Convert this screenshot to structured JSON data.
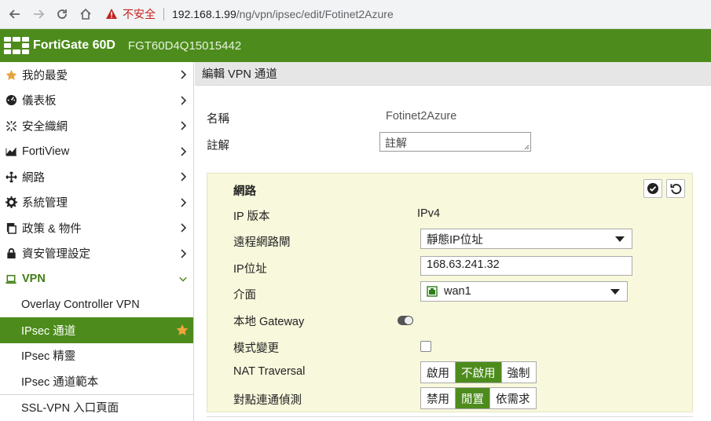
{
  "browser": {
    "security_label": "不安全",
    "url_host": "192.168.1.99",
    "url_path": "/ng/vpn/ipsec/edit/Fotinet2Azure"
  },
  "header": {
    "product": "FortiGate 60D",
    "serial": "FGT60D4Q15015442",
    "brand_color": "#4d8c1c"
  },
  "sidebar": {
    "items": [
      {
        "label": "我的最愛",
        "icon": "star-icon"
      },
      {
        "label": "儀表板",
        "icon": "dashboard-icon"
      },
      {
        "label": "安全織網",
        "icon": "fabric-icon"
      },
      {
        "label": "FortiView",
        "icon": "chart-icon"
      },
      {
        "label": "網路",
        "icon": "network-icon"
      },
      {
        "label": "系統管理",
        "icon": "gear-icon"
      },
      {
        "label": "政策 & 物件",
        "icon": "policy-icon"
      },
      {
        "label": "資安管理設定",
        "icon": "lock-icon"
      },
      {
        "label": "VPN",
        "icon": "laptop-icon"
      }
    ],
    "vpn_subitems": [
      {
        "label": "Overlay Controller VPN"
      },
      {
        "label": "IPsec 通道"
      },
      {
        "label": "IPsec 精靈"
      },
      {
        "label": "IPsec 通道範本"
      },
      {
        "label": "SSL-VPN 入口頁面"
      }
    ]
  },
  "main": {
    "page_title": "編輯 VPN 通道",
    "name_label": "名稱",
    "name_value": "Fotinet2Azure",
    "comment_label": "註解",
    "comment_placeholder": "註解",
    "network": {
      "title": "網路",
      "ip_version_label": "IP 版本",
      "ip_version_value": "IPv4",
      "remote_gateway_label": "遠程網路閘",
      "remote_gateway_value": "靜態IP位址",
      "ip_address_label": "IP位址",
      "ip_address_value": "168.63.241.32",
      "interface_label": "介面",
      "interface_value": "wan1",
      "local_gateway_label": "本地 Gateway",
      "mode_config_label": "模式變更",
      "nat_traversal_label": "NAT Traversal",
      "nat_traversal_options": [
        "啟用",
        "不啟用",
        "強制"
      ],
      "nat_traversal_selected": "不啟用",
      "dpd_label": "對點連通偵測",
      "dpd_options": [
        "禁用",
        "閒置",
        "依需求"
      ],
      "dpd_selected": "閒置"
    }
  }
}
